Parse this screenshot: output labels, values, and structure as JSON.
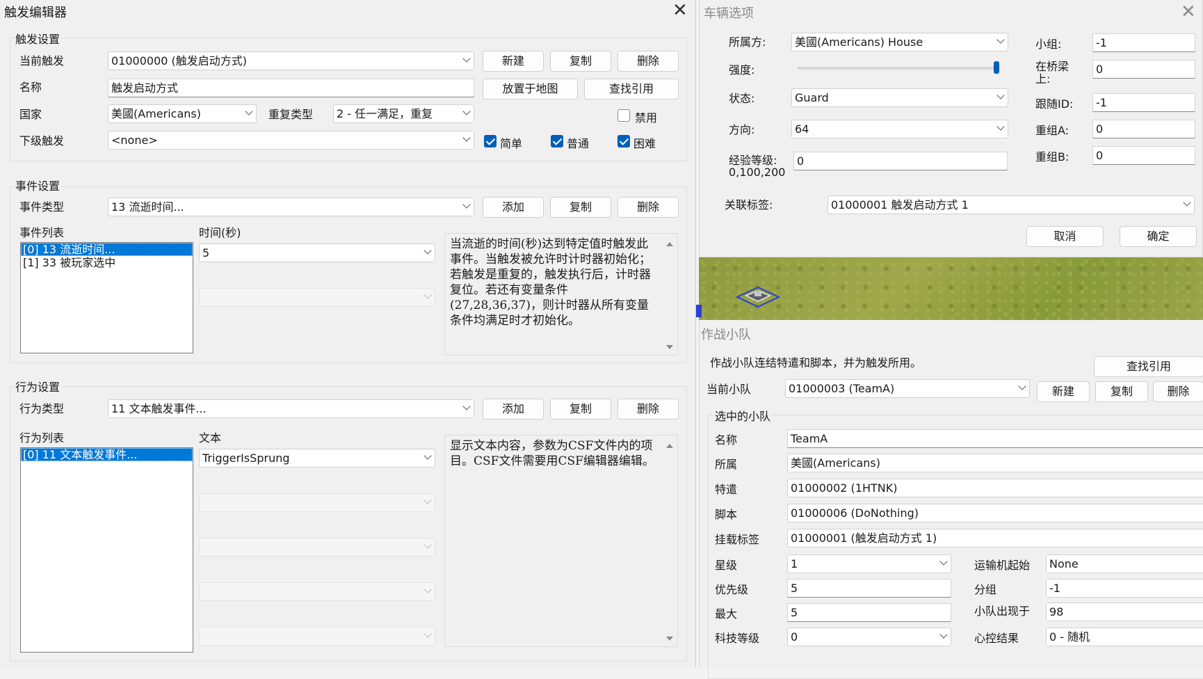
{
  "trigger_editor": {
    "title": "触发编辑器",
    "trigger_group": {
      "label": "触发设置",
      "current_trigger_label": "当前触发",
      "current_trigger_value": "01000000 (触发启动方式)",
      "name_label": "名称",
      "name_value": "触发启动方式",
      "country_label": "国家",
      "country_value": "美國(Americans)",
      "repeat_label": "重复类型",
      "repeat_value": "2 - 任一满足，重复",
      "sub_trigger_label": "下级触发",
      "sub_trigger_value": "<none>",
      "btn_new": "新建",
      "btn_copy": "复制",
      "btn_delete": "删除",
      "btn_place_map": "放置于地图",
      "btn_find_ref": "查找引用",
      "disable_label": "禁用",
      "disable_checked": false,
      "easy_label": "简单",
      "normal_label": "普通",
      "hard_label": "困难"
    },
    "event_group": {
      "label": "事件设置",
      "type_label": "事件类型",
      "type_value": "13 流逝时间...",
      "btn_add": "添加",
      "btn_copy": "复制",
      "btn_delete": "删除",
      "list_label": "事件列表",
      "list_items": [
        "[0] 13 流逝时间...",
        "[1] 33 被玩家选中"
      ],
      "param_label": "时间(秒)",
      "param_value": "5",
      "description": "当流逝的时间(秒)达到特定值时触发此事件。当触发被允许时计时器初始化；若触发是重复的，触发执行后，计时器复位。若还有变量条件(27,28,36,37)，则计时器从所有变量条件均满足时才初始化。"
    },
    "action_group": {
      "label": "行为设置",
      "type_label": "行为类型",
      "type_value": "11 文本触发事件...",
      "btn_add": "添加",
      "btn_copy": "复制",
      "btn_delete": "删除",
      "list_label": "行为列表",
      "list_items": [
        "[0] 11 文本触发事件..."
      ],
      "param_label": "文本",
      "param_value": "TriggerIsSprung",
      "description": "显示文本内容，参数为CSF文件内的项目。CSF文件需要用CSF编辑器编辑。"
    }
  },
  "vehicle_options": {
    "title": "车辆选项",
    "owner_label": "所属方:",
    "owner_value": "美國(Americans) House",
    "strength_label": "强度:",
    "strength_level": 1.0,
    "state_label": "状态:",
    "state_value": "Guard",
    "direction_label": "方向:",
    "direction_value": "64",
    "veteran_label": "经验等级:",
    "veteran_hint": "0,100,200",
    "veteran_value": "0",
    "group_label": "小组:",
    "group_value": "-1",
    "on_bridge_label": "在桥梁上:",
    "on_bridge_value": "0",
    "follow_label": "跟随ID:",
    "follow_value": "-1",
    "regroup_a_label": "重组A:",
    "regroup_a_value": "0",
    "regroup_b_label": "重组B:",
    "regroup_b_value": "0",
    "tag_label": "关联标签:",
    "tag_value": "01000001 触发启动方式 1",
    "btn_cancel": "取消",
    "btn_ok": "确定"
  },
  "team_panel": {
    "title": "作战小队",
    "intro": "作战小队连结特遣和脚本，并为触发所用。",
    "btn_find_ref": "查找引用",
    "current_label": "当前小队",
    "current_value": "01000003 (TeamA)",
    "btn_new": "新建",
    "btn_copy": "复制",
    "btn_delete": "删除",
    "selected_group_label": "选中的小队",
    "name_label": "名称",
    "name_value": "TeamA",
    "owner_label": "所属",
    "owner_value": "美國(Americans)",
    "taskforce_label": "特遣",
    "taskforce_value": "01000002 (1HTNK)",
    "script_label": "脚本",
    "script_value": "01000006 (DoNothing)",
    "tag_label": "挂载标签",
    "tag_value": "01000001 (触发启动方式 1)",
    "veteran_label": "星级",
    "veteran_value": "1",
    "transport_label": "运输机起始",
    "transport_value": "None",
    "priority_label": "优先级",
    "priority_value": "5",
    "group_label": "分组",
    "group_value": "-1",
    "max_label": "最大",
    "max_value": "5",
    "waypoint_label": "小队出现于",
    "waypoint_value": "98",
    "tech_label": "科技等级",
    "tech_value": "0",
    "mind_label": "心控结果",
    "mind_value": "0 - 随机"
  }
}
